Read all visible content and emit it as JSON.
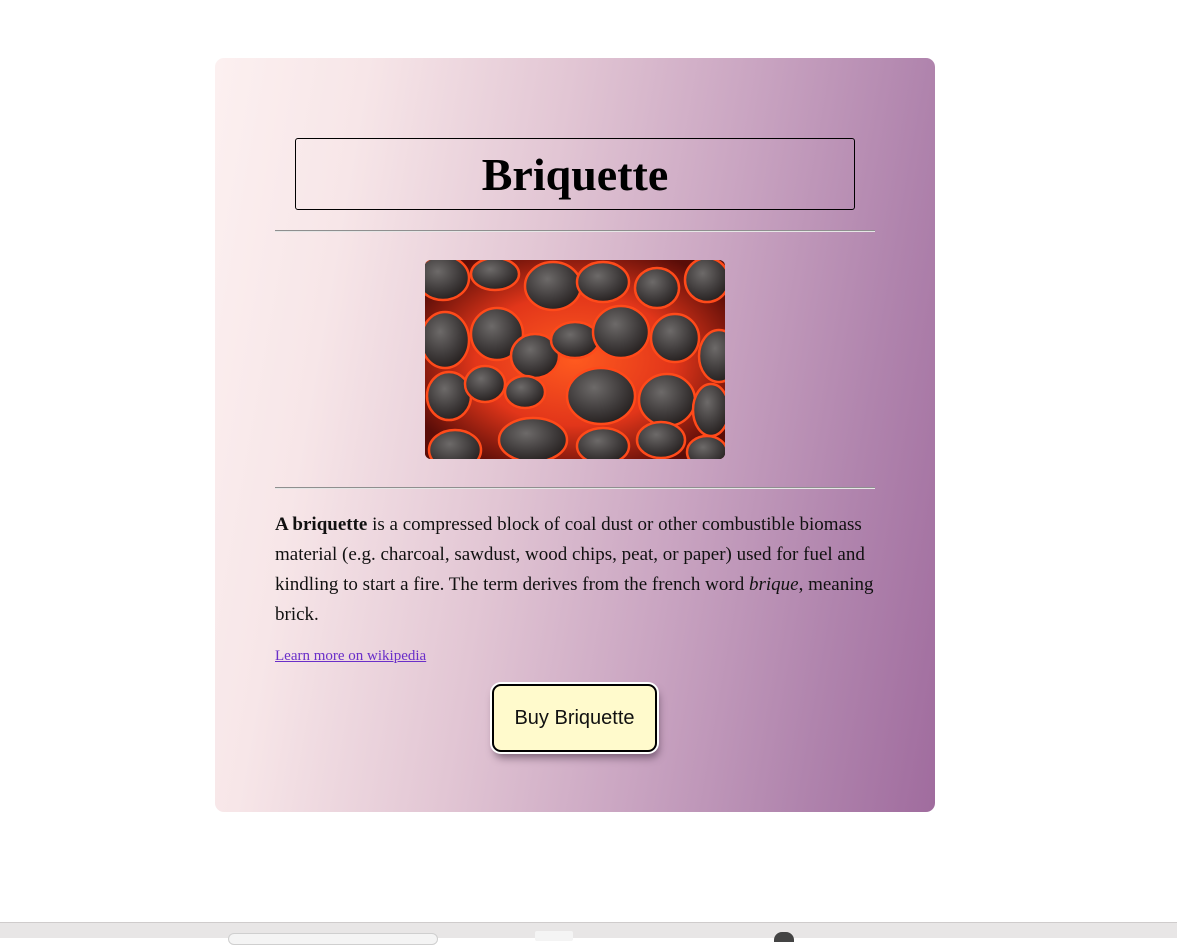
{
  "card": {
    "title": "Briquette",
    "description": {
      "bold_lead": "A briquette",
      "text_1": " is a compressed block of coal dust or other combustible biomass material (e.g. charcoal, sawdust, wood chips, peat, or paper) used for fuel and kindling to start a fire. The term derives from the french word ",
      "italic_word": "brique",
      "text_2": ", meaning brick."
    },
    "link_text": "Learn more on wikipedia",
    "buy_button_label": "Buy Briquette"
  },
  "colors": {
    "gradient_start": "#fcf0f0",
    "gradient_end": "#a06c9e",
    "button_bg": "#fffacc",
    "link": "#6a2fc9"
  }
}
